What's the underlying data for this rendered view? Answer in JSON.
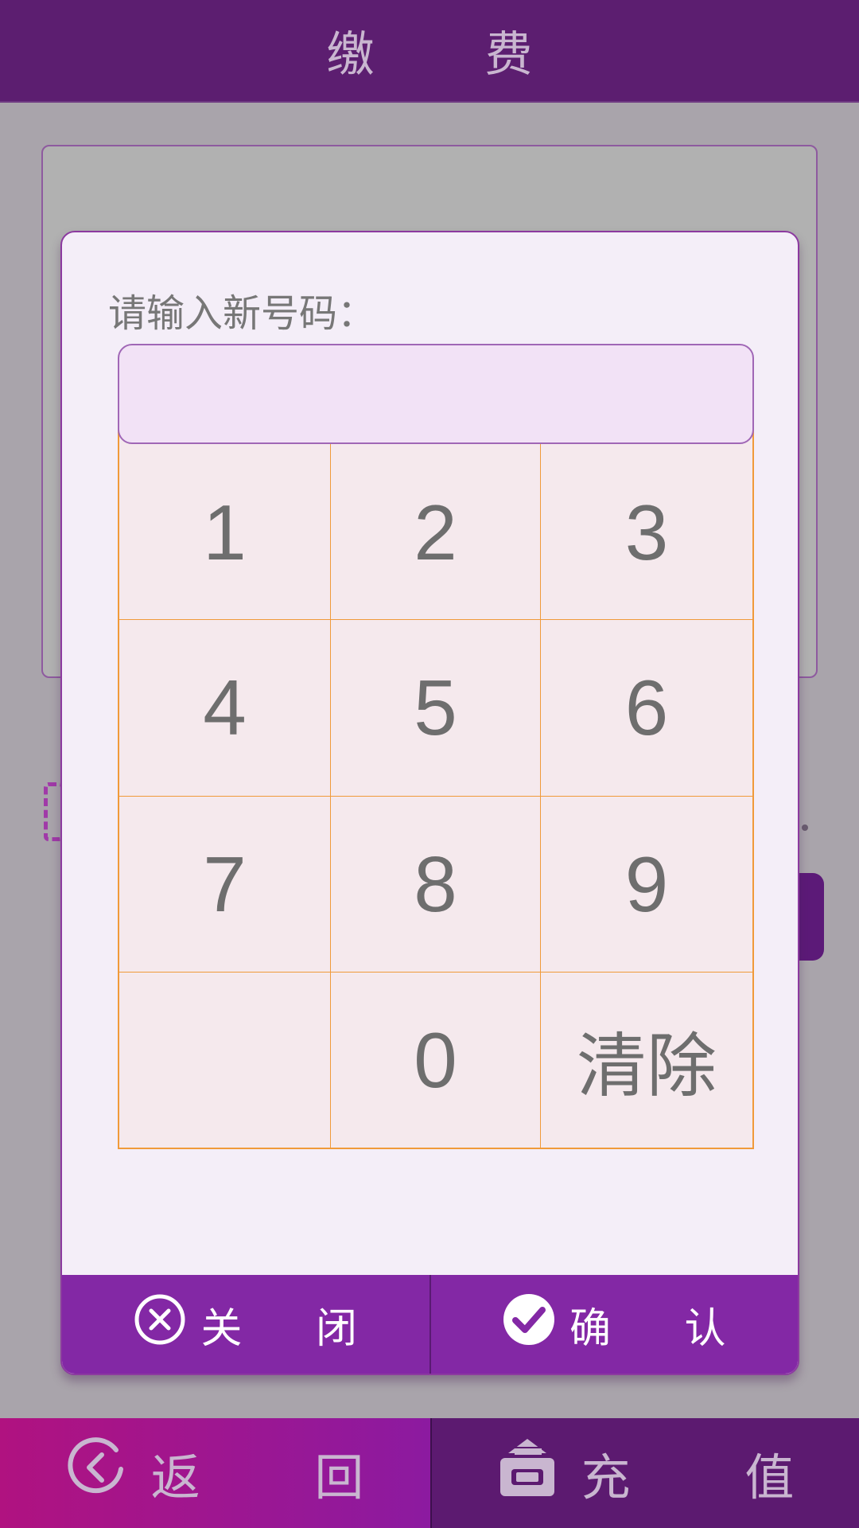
{
  "header": {
    "title": "缴 费"
  },
  "dialog": {
    "prompt": "请输入新号码：",
    "number_value": "",
    "keypad": {
      "keys": [
        "1",
        "2",
        "3",
        "4",
        "5",
        "6",
        "7",
        "8",
        "9",
        "",
        "0",
        "清除"
      ]
    },
    "close_label": "关 闭",
    "confirm_label": "确 认"
  },
  "bottom_bar": {
    "back_label": "返 回",
    "recharge_label": "充 值"
  },
  "colors": {
    "header_bg": "#5c1e70",
    "dialog_footer_bg": "#8328a5",
    "keypad_border": "#f09a3a",
    "accent": "#8c3aa0"
  },
  "icons": {
    "close": "circle-x-icon",
    "confirm": "check-circle-icon",
    "back": "circle-chevron-left-icon",
    "recharge": "card-reader-icon"
  }
}
